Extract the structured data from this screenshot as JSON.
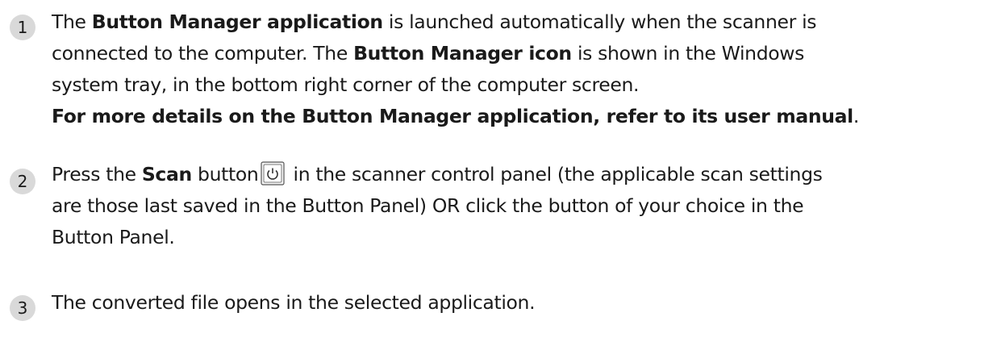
{
  "steps": [
    {
      "number": "1",
      "line1": {
        "a": "The ",
        "b1": "Button Manager application",
        "c": " is launched automatically when the scanner is"
      },
      "line2": {
        "a": "connected to the computer. The ",
        "b1": "Button Manager icon",
        "c": " is shown in the Windows"
      },
      "line3": "system tray, in the bottom right corner of the computer screen.",
      "line4": {
        "b1": "For more details on the Button Manager application, refer to its user manual",
        "c": "."
      }
    },
    {
      "number": "2",
      "line1": {
        "a": "Press the ",
        "b1": "Scan",
        "c": " button",
        "d": " in the scanner control panel (the applicable scan settings"
      },
      "line2": "are those last saved in the Button Panel) OR click the button of your choice in the",
      "line3": "Button Panel."
    },
    {
      "number": "3",
      "line1": "The converted file opens in the selected application."
    }
  ],
  "icons": {
    "scan_button": "power-button-icon"
  }
}
